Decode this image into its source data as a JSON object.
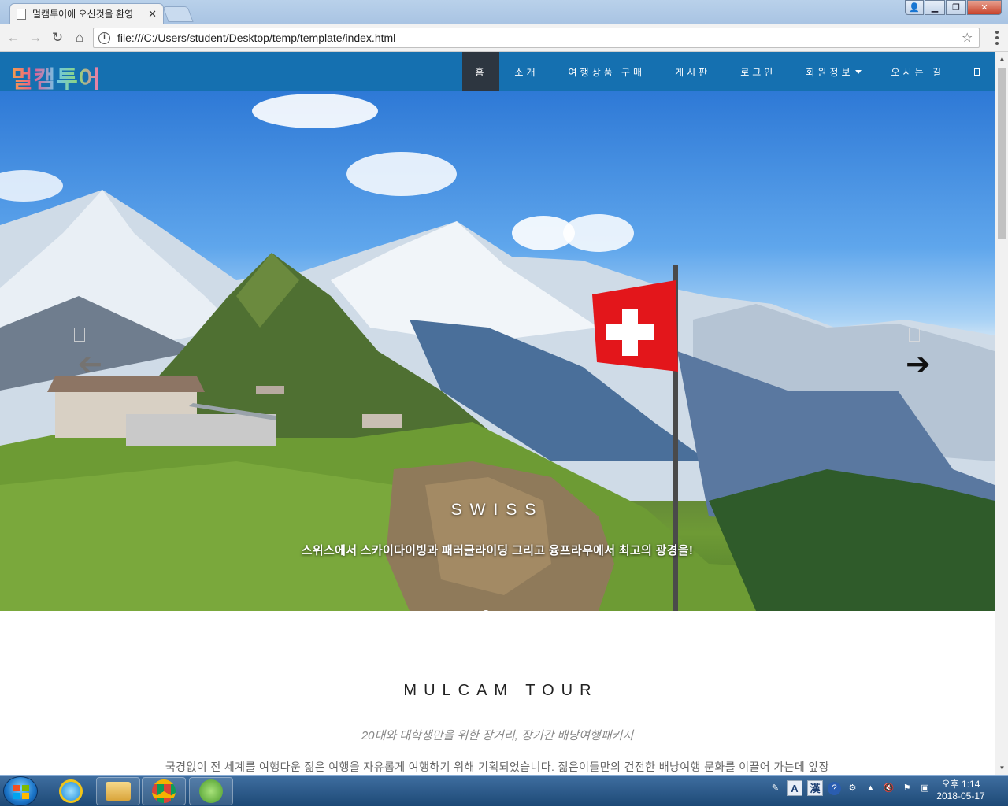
{
  "browser": {
    "tab_title": "멀캠투어에 오신것을 환영",
    "tab_close": "✕",
    "url": "file:///C:/Users/student/Desktop/temp/template/index.html",
    "info_glyph": "i",
    "back_glyph": "←",
    "forward_glyph": "→",
    "reload_glyph": "↻",
    "home_glyph": "⌂",
    "star_glyph": "☆",
    "window_buttons": {
      "user": "👤",
      "minimize": "▁",
      "maximize": "❐",
      "close": "✕"
    }
  },
  "site": {
    "logo": "멀캠투어",
    "nav": [
      {
        "label": "홈",
        "active": true
      },
      {
        "label": "소개"
      },
      {
        "label": "여행상품 구매"
      },
      {
        "label": "게시판"
      },
      {
        "label": "로그인"
      },
      {
        "label": "회원정보",
        "dropdown": true
      },
      {
        "label": "오시는 길"
      }
    ]
  },
  "hero": {
    "title": "SWISS",
    "caption": "스위스에서 스카이다이빙과 패러글라이딩 그리고 융프라우에서 최고의 광경을!",
    "next_arrow": "➔",
    "prev_arrow": "➔",
    "slides_total": 3,
    "active_slide": 1
  },
  "intro": {
    "heading": "MULCAM TOUR",
    "subtitle": "20대와 대학생만을 위한 장거리, 장기간 배낭여행패키지",
    "body": "국경없이 전 세계를 여행다운 젊은 여행을 자유롭게 여행하기 위해 기획되었습니다. 젊은이들만의 건전한 배낭여행 문화를 이끌어 가는데 앞장"
  },
  "taskbar": {
    "ime_a": "A",
    "ime_han": "漢",
    "help": "?",
    "clock_time": "오후 1:14",
    "clock_date": "2018-05-17"
  },
  "colors": {
    "nav_bg": "#1570b0",
    "nav_active": "#2d3640",
    "swiss_red": "#e3161b"
  }
}
